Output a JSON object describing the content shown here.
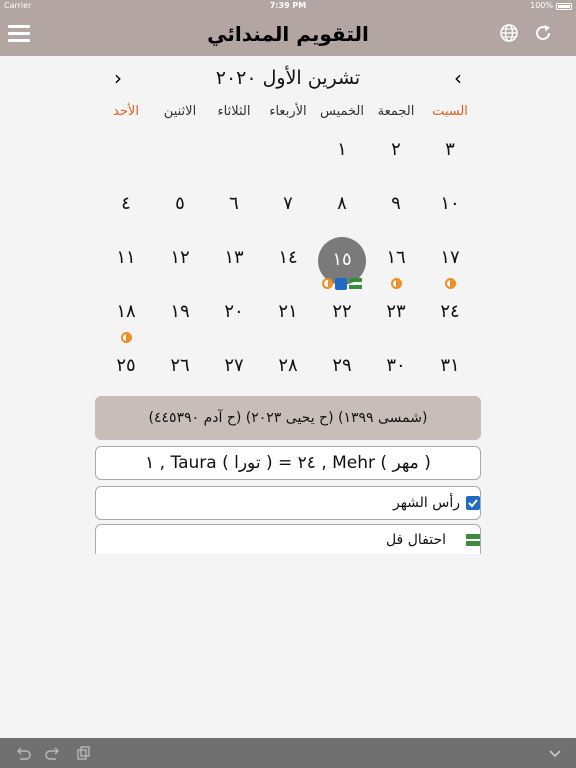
{
  "status_bar": {
    "carrier": "Carrier",
    "time": "7:39 PM",
    "battery": "100%"
  },
  "nav": {
    "title": "التقويم المندائي",
    "left_icon": "hamburger-menu-icon",
    "right_icons": [
      "globe-icon",
      "refresh-icon"
    ]
  },
  "month": {
    "title": "تشرين الأول ٢٠٢٠",
    "prev_symbol": "‹",
    "next_symbol": "›"
  },
  "weekdays": [
    {
      "label": "السبت",
      "highlight": true
    },
    {
      "label": "الجمعة",
      "highlight": false
    },
    {
      "label": "الخميس",
      "highlight": false
    },
    {
      "label": "الأربعاء",
      "highlight": false
    },
    {
      "label": "الثلاثاء",
      "highlight": false
    },
    {
      "label": "الاثنين",
      "highlight": false
    },
    {
      "label": "الأحد",
      "highlight": true
    }
  ],
  "weeks": [
    [
      "٣",
      "٢",
      "١",
      "",
      "",
      "",
      ""
    ],
    [
      "١٠",
      "٩",
      "٨",
      "٧",
      "٦",
      "٥",
      "٤"
    ],
    [
      "١٧",
      "١٦",
      "١٥",
      "١٤",
      "١٣",
      "١٢",
      "١١"
    ],
    [
      "٢٤",
      "٢٣",
      "٢٢",
      "٢١",
      "٢٠",
      "١٩",
      "١٨"
    ],
    [
      "٣١",
      "٣٠",
      "٢٩",
      "٢٨",
      "٢٧",
      "٢٦",
      "٢٥"
    ]
  ],
  "today": "١٥",
  "day_marks": {
    "١٥": [
      "half-moon-icon",
      "check-square-icon",
      "double-bar-icon"
    ],
    "١٦": [
      "half-moon-icon"
    ],
    "١٧": [
      "half-moon-icon"
    ],
    "١٨": [
      "half-moon-icon"
    ]
  },
  "info_line": "(شمسى ١٣٩٩)  (ح يحيى ٢٠٢٣)  (ح آدم ٤٤٥٣٩٠)",
  "conversion_line": "( مهر ) Mehr , ٢٤   =   ( تورا ) Taura , ١",
  "events": [
    {
      "label": "رأس الشهر",
      "icon": "check-square-icon"
    },
    {
      "label": "احتفال فل",
      "icon": "double-bar-icon"
    }
  ],
  "toolbar": {
    "icons": [
      "undo-icon",
      "redo-icon",
      "copy-icon",
      "chevron-down-icon"
    ]
  },
  "colors": {
    "nav_bg": "#b3a5a1",
    "weekend_red": "#e0601f",
    "moon_orange": "#ef8c22",
    "check_blue": "#1f6bc4",
    "bar_green": "#3a8b3a",
    "today_circle": "#7a7a7a"
  }
}
